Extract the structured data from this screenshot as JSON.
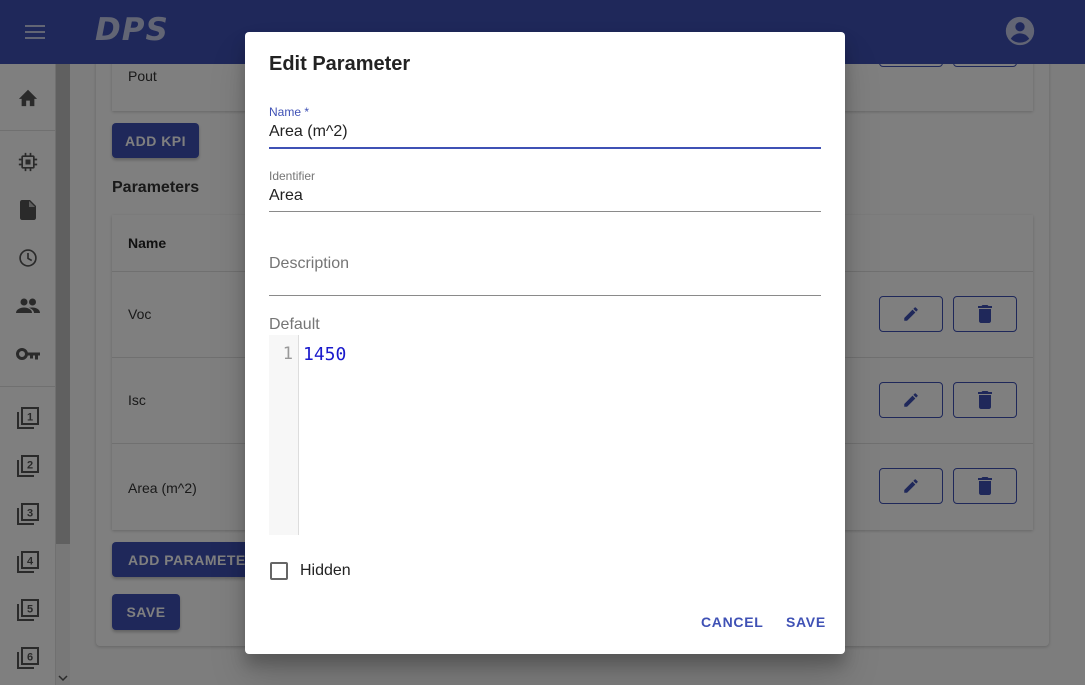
{
  "app": {
    "logo": "DPS"
  },
  "sidebar": {
    "items": [
      {
        "icon": "home-icon"
      },
      {
        "icon": "chip-icon"
      },
      {
        "icon": "document-icon"
      },
      {
        "icon": "clock-icon"
      },
      {
        "icon": "people-icon"
      },
      {
        "icon": "key-icon"
      },
      {
        "icon": "filter-1-icon",
        "label": "1"
      },
      {
        "icon": "filter-2-icon",
        "label": "2"
      },
      {
        "icon": "filter-3-icon",
        "label": "3"
      },
      {
        "icon": "filter-4-icon",
        "label": "4"
      },
      {
        "icon": "filter-5-icon",
        "label": "5"
      },
      {
        "icon": "filter-6-icon",
        "label": "6"
      }
    ]
  },
  "main": {
    "kpi_row_label": "Pout",
    "add_kpi_label": "ADD KPI",
    "parameters_title": "Parameters",
    "table": {
      "header_name": "Name",
      "rows": [
        {
          "name": "Voc"
        },
        {
          "name": "Isc"
        },
        {
          "name": "Area (m^2)"
        }
      ]
    },
    "add_parameter_label": "ADD PARAMETER",
    "save_label": "SAVE"
  },
  "dialog": {
    "title": "Edit Parameter",
    "name_label": "Name *",
    "name_value": "Area (m^2)",
    "identifier_label": "Identifier",
    "identifier_value": "Area",
    "description_label": "Description",
    "description_value": "",
    "default_label": "Default",
    "default_line_number": "1",
    "default_code": "1450",
    "hidden_label": "Hidden",
    "hidden_checked": false,
    "cancel_label": "CANCEL",
    "save_label": "SAVE"
  },
  "colors": {
    "primary": "#3f51b5",
    "logo": "#c5cae9",
    "code_number": "#1a1acc"
  }
}
